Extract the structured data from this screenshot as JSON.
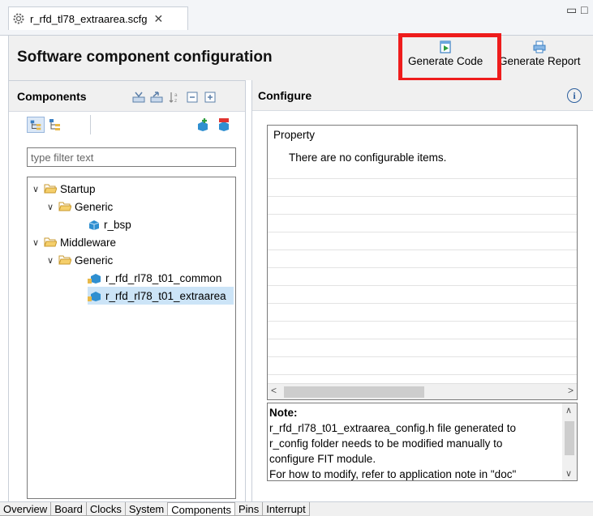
{
  "editor_tab": {
    "filename": "r_rfd_tl78_extraarea.scfg",
    "close_glyph": "✕"
  },
  "window_controls": {
    "minimize": "▭",
    "maximize": "□"
  },
  "header": {
    "title": "Software component configuration",
    "generate_code_label": "Generate Code",
    "generate_report_label": "Generate Report"
  },
  "components_panel": {
    "title": "Components",
    "filter_placeholder": "type filter text",
    "tree": {
      "startup": "Startup",
      "startup_generic": "Generic",
      "r_bsp": "r_bsp",
      "middleware": "Middleware",
      "middleware_generic": "Generic",
      "rfd_common": "r_rfd_rl78_t01_common",
      "rfd_extraarea": "r_rfd_rl78_t01_extraarea"
    },
    "toolbar_icons": [
      "collapse-all-icon",
      "expand-all-icon",
      "sort-icon",
      "minimize-tree-icon",
      "maximize-tree-icon"
    ]
  },
  "configure_panel": {
    "title": "Configure",
    "column_header": "Property",
    "empty_message": "There are no configurable items.",
    "note_title": "Note:",
    "note_lines": [
      "r_rfd_rl78_t01_extraarea_config.h file generated to",
      "r_config folder needs to be modified manually to",
      "configure FIT module.",
      "For how to modify, refer to application note in \"doc\""
    ]
  },
  "bottom_tabs": [
    "Overview",
    "Board",
    "Clocks",
    "System",
    "Components",
    "Pins",
    "Interrupt"
  ],
  "active_bottom_tab": "Components",
  "colors": {
    "highlight": "#ee1c1c",
    "selection": "#cce4f7",
    "folder": "#e8b94a"
  }
}
